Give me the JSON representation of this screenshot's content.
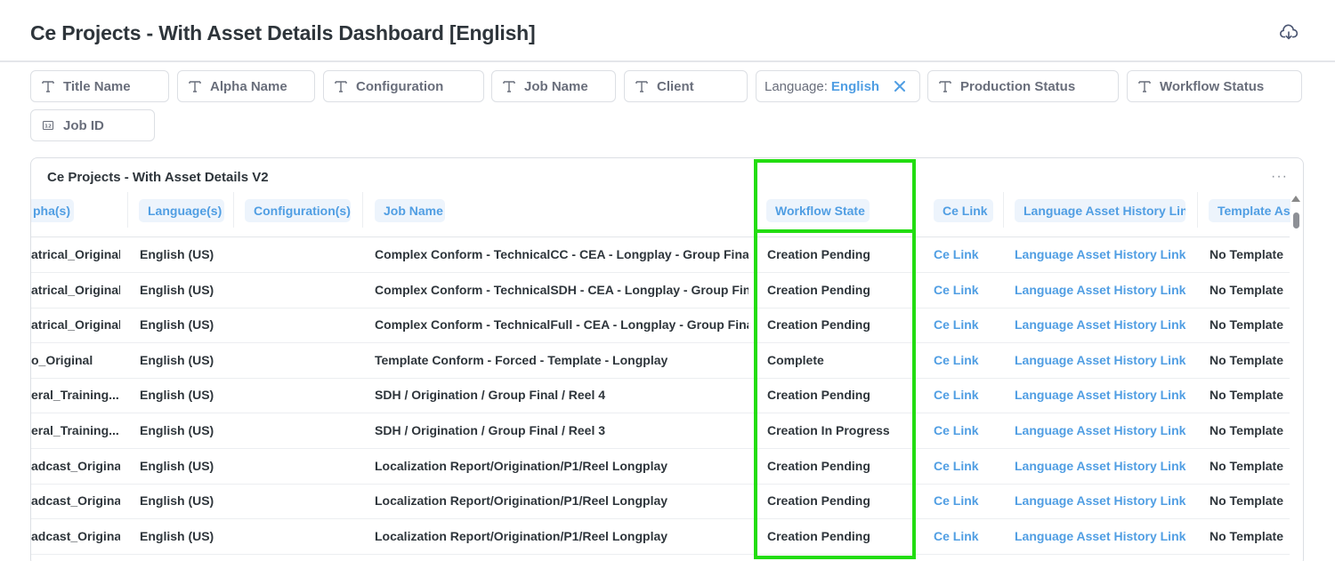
{
  "dashboard": {
    "title": "Ce Projects - With Asset Details Dashboard [English]",
    "download_icon": "cloud-download-icon"
  },
  "filters": {
    "title_name": "Title Name",
    "alpha_name": "Alpha Name",
    "configuration": "Configuration",
    "job_name": "Job Name",
    "client": "Client",
    "language_key": "Language:",
    "language_value": "English",
    "production_status": "Production Status",
    "workflow_status": "Workflow Status",
    "job_id": "Job ID"
  },
  "card": {
    "title": "Ce Projects - With Asset Details V2",
    "menu": "···"
  },
  "columns": {
    "alphas": "pha(s)",
    "languages": "Language(s)",
    "configurations": "Configuration(s)",
    "job_name": "Job Name",
    "workflow_state": "Workflow State",
    "ce_link": "Ce Link",
    "lang_asset_history": "Language Asset History Link",
    "template_asset": "Template Ass"
  },
  "rows": [
    {
      "alpha": "atrical_Original",
      "language": "English (US)",
      "job": "Complex Conform - TechnicalCC - CEA - Longplay - Group Final",
      "state": "Creation Pending",
      "ce": "Ce Link",
      "history": "Language Asset History Link",
      "template": "No Template"
    },
    {
      "alpha": "atrical_Original",
      "language": "English (US)",
      "job": "Complex Conform - TechnicalSDH - CEA - Longplay - Group Final",
      "state": "Creation Pending",
      "ce": "Ce Link",
      "history": "Language Asset History Link",
      "template": "No Template"
    },
    {
      "alpha": "atrical_Original",
      "language": "English (US)",
      "job": "Complex Conform - TechnicalFull - CEA - Longplay - Group Final",
      "state": "Creation Pending",
      "ce": "Ce Link",
      "history": "Language Asset History Link",
      "template": "No Template"
    },
    {
      "alpha": "o_Original",
      "language": "English (US)",
      "job": "Template Conform - Forced - Template - Longplay",
      "state": "Complete",
      "ce": "Ce Link",
      "history": "Language Asset History Link",
      "template": "No Template"
    },
    {
      "alpha": "eral_Training...",
      "language": "English (US)",
      "job": "SDH / Origination  / Group Final / Reel 4",
      "state": "Creation Pending",
      "ce": "Ce Link",
      "history": "Language Asset History Link",
      "template": "No Template"
    },
    {
      "alpha": "eral_Training...",
      "language": "English (US)",
      "job": "SDH / Origination  / Group Final / Reel 3",
      "state": "Creation In Progress",
      "ce": "Ce Link",
      "history": "Language Asset History Link",
      "template": "No Template"
    },
    {
      "alpha": "adcast_Original",
      "language": "English (US)",
      "job": "Localization Report/Origination/P1/Reel Longplay",
      "state": "Creation Pending",
      "ce": "Ce Link",
      "history": "Language Asset History Link",
      "template": "No Template"
    },
    {
      "alpha": "adcast_Original",
      "language": "English (US)",
      "job": "Localization Report/Origination/P1/Reel Longplay",
      "state": "Creation Pending",
      "ce": "Ce Link",
      "history": "Language Asset History Link",
      "template": "No Template"
    },
    {
      "alpha": "adcast_Original",
      "language": "English (US)",
      "job": "Localization Report/Origination/P1/Reel Longplay",
      "state": "Creation Pending",
      "ce": "Ce Link",
      "history": "Language Asset History Link",
      "template": "No Template"
    }
  ],
  "highlight": {
    "color": "#22dd11",
    "target": "Workflow State"
  }
}
